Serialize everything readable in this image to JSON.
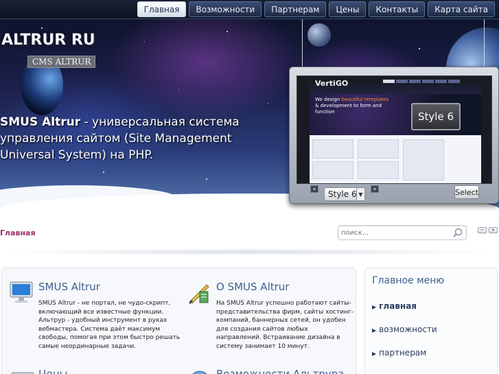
{
  "nav": {
    "items": [
      {
        "label": "Главная",
        "active": true
      },
      {
        "label": "Возможности",
        "active": false
      },
      {
        "label": "Партнерам",
        "active": false
      },
      {
        "label": "Цены",
        "active": false
      },
      {
        "label": "Контакты",
        "active": false
      },
      {
        "label": "Карта сайта",
        "active": false
      }
    ]
  },
  "header": {
    "site_title": "ALTRUR RU",
    "site_subtitle": "CMS ALTRUR",
    "tagline_bold": "SMUS Altrur",
    "tagline_rest": " - универсальная система управления сайтом (Site Management Universal System) на PHP."
  },
  "preview": {
    "screen_logo": "VertiGO",
    "screen_headline_pre": "We design ",
    "screen_headline_em": "beautiful templates",
    "screen_headline_post": " & development to form and function",
    "style_badge": "Style 6",
    "selected_style": "Style 6",
    "prev_label": "«",
    "next_label": "»",
    "select_label": "Select"
  },
  "breadcrumb": {
    "label": "Главная"
  },
  "search": {
    "placeholder": "поиск..."
  },
  "font_size": {
    "decrease": "−",
    "increase": "+"
  },
  "features": [
    {
      "title": "SMUS Altrur",
      "icon": "monitor-icon",
      "text": "SMUS Altrur - не портал, не чудо-скрипт, включающий все известные функции. Альтрур - удобный инструмент в руках вебмастера. Система даёт максимум свободы, помогая при этом быстро решать самые неординарные задачи."
    },
    {
      "title": "О SMUS Altrur",
      "icon": "tools-icon",
      "text": "На SMUS Altrur успешно работают сайты-представительства фирм, сайты хостинг-компаний, баннерных сетей, он удобен для создания сайтов любых направлений. Встраивание дизайна в систему занимает 10 минут."
    },
    {
      "title": "Цены",
      "icon": "price-icon",
      "text": ""
    },
    {
      "title": "Возможности Альтрура",
      "icon": "globe-icon",
      "text": ""
    }
  ],
  "sidebar": {
    "title": "Главное меню",
    "items": [
      {
        "label": "главная",
        "active": true
      },
      {
        "label": "возможности",
        "active": false
      },
      {
        "label": "партнерам",
        "active": false
      }
    ]
  },
  "colors": {
    "accent": "#3d5f8f",
    "breadcrumb": "#9b2f6c",
    "nav_active_bg": "#ffffff"
  }
}
